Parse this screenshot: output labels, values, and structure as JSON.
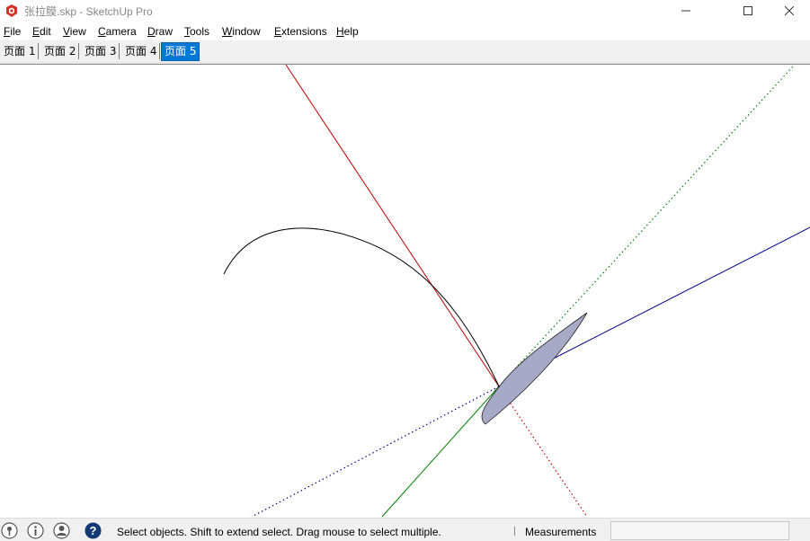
{
  "window": {
    "title": "张拉膜.skp - SketchUp Pro",
    "icon": "sketchup-logo-icon",
    "controls": [
      "minimize-icon",
      "maximize-icon",
      "close-icon"
    ]
  },
  "menu": {
    "items": [
      "File",
      "Edit",
      "View",
      "Camera",
      "Draw",
      "Tools",
      "Window",
      "Extensions",
      "Help"
    ]
  },
  "scenes": {
    "tabs": [
      "页面 1",
      "页面 2",
      "页面 3",
      "页面 4",
      "页面 5"
    ],
    "active": "页面 5"
  },
  "colors": {
    "red_axis": "#c00000",
    "green_axis": "#008000",
    "blue_axis": "#00008b",
    "face_fill": "#a7aac6",
    "active_tab": "#0078d7"
  },
  "statusbar": {
    "icons": [
      "geolocation-icon",
      "credits-icon",
      "user-account-icon",
      "help-icon"
    ],
    "message": "Select objects. Shift to extend select. Drag mouse to select multiple.",
    "measurements_label": "Measurements",
    "measurements_value": ""
  }
}
